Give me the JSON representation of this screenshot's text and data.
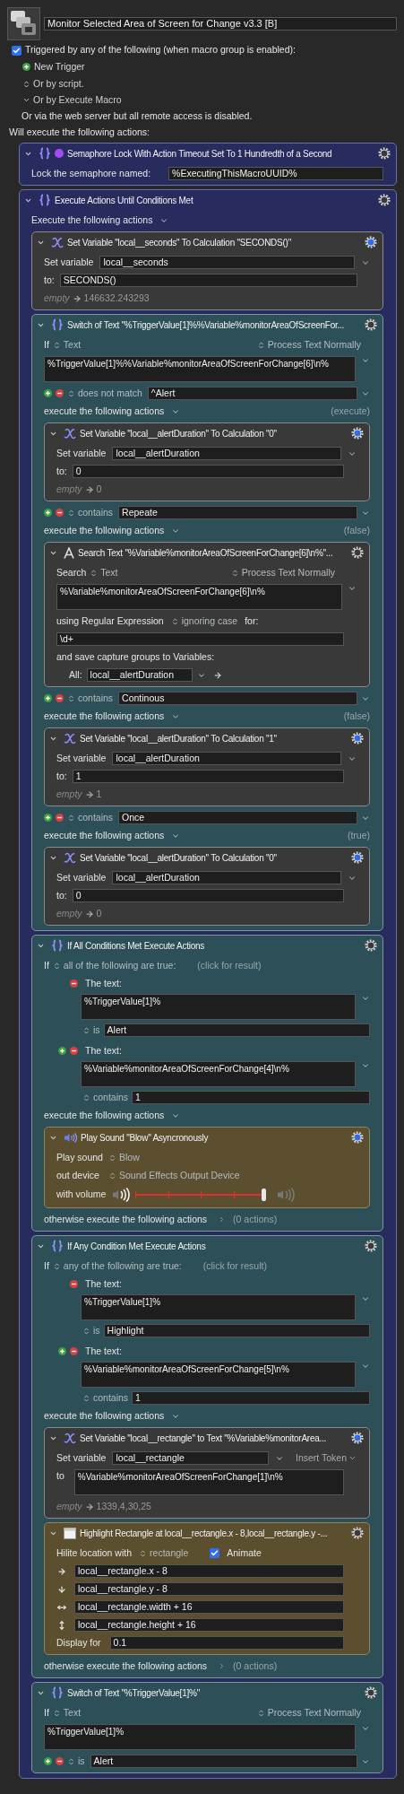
{
  "macro": {
    "title": "Monitor Selected Area of Screen for Change v3.3 [B]",
    "enabled": true,
    "triggered_label": "Triggered by any of the following (when macro group is enabled):",
    "new_trigger": "New Trigger",
    "script_option": "Or by script.",
    "execute_macro_option": "Or by Execute Macro",
    "web_note": "Or via the web server but all remote access is disabled.",
    "actions_heading": "Will execute the following actions:"
  },
  "actions": [
    {
      "kind": "semaphore",
      "title": "Semaphore Lock With Action Timeout Set To 1 Hundredth of a Second",
      "gear_active": false,
      "label": "Lock the semaphore named:",
      "value": "%ExecutingThisMacroUUID%"
    },
    {
      "kind": "until",
      "title": "Execute Actions Until Conditions Met",
      "gear_active": false,
      "exec_label": "Execute the following actions",
      "actions": [
        {
          "kind": "setvar",
          "title": "Set Variable \"local__seconds\" To Calculation \"SECONDS()\"",
          "gear_active": true,
          "var_label": "Set variable",
          "variable": "local__seconds",
          "to_label": "to:",
          "value": "SECONDS()",
          "result_label": "empty",
          "result": "146632.243293"
        },
        {
          "kind": "switch",
          "title": "Switch of Text \"%TriggerValue[1]%%Variable%monitorAreaOfScreenFor...",
          "gear_active": false,
          "if_label": "If",
          "source": "Text",
          "process": "Process Text Normally",
          "text": "%TriggerValue[1]%%Variable%monitorAreaOfScreenForChange[6]\\n%",
          "cases": [
            {
              "op": "does not match",
              "value": "^Alert",
              "exec_label": "execute the following actions",
              "status": "(execute)",
              "actions": [
                {
                  "kind": "setvar",
                  "title": "Set Variable \"local__alertDuration\" To Calculation \"0\"",
                  "gear_active": true,
                  "var_label": "Set variable",
                  "variable": "local__alertDuration",
                  "to_label": "to:",
                  "value": "0",
                  "result_label": "empty",
                  "result": "0"
                }
              ]
            },
            {
              "op": "contains",
              "value": "Repeate",
              "exec_label": "execute the following actions",
              "status": "(false)",
              "actions": [
                {
                  "kind": "search",
                  "title": "Search Text \"%Variable%monitorAreaOfScreenForChange[6]\\n%\"...",
                  "gear_active": false,
                  "search_label": "Search",
                  "source": "Text",
                  "process": "Process Text Normally",
                  "text": "%Variable%monitorAreaOfScreenForChange[6]\\n%",
                  "regex_label": "using Regular Expression",
                  "case_option": "ignoring case",
                  "for_label": "for:",
                  "pattern": "\\d+",
                  "capture_label": "and save capture groups to Variables:",
                  "all_label": "All:",
                  "variable": "local__alertDuration"
                }
              ]
            },
            {
              "op": "contains",
              "value": "Continous",
              "exec_label": "execute the following actions",
              "status": "(false)",
              "actions": [
                {
                  "kind": "setvar",
                  "title": "Set Variable \"local__alertDuration\" To Calculation \"1\"",
                  "gear_active": true,
                  "var_label": "Set variable",
                  "variable": "local__alertDuration",
                  "to_label": "to:",
                  "value": "1",
                  "result_label": "empty",
                  "result": "1"
                }
              ]
            },
            {
              "op": "contains",
              "value": "Once",
              "exec_label": "execute the following actions",
              "status": "(true)",
              "actions": [
                {
                  "kind": "setvar",
                  "title": "Set Variable \"local__alertDuration\" To Calculation \"0\"",
                  "gear_active": true,
                  "var_label": "Set variable",
                  "variable": "local__alertDuration",
                  "to_label": "to:",
                  "value": "0",
                  "result_label": "empty",
                  "result": "0"
                }
              ]
            }
          ]
        },
        {
          "kind": "if",
          "title": "If All Conditions Met Execute Actions",
          "gear_active": false,
          "if_label": "If",
          "mode": "all of the following are true:",
          "result_hint": "(click for result)",
          "conditions": [
            {
              "can_add": false,
              "label": "The text:",
              "text": "%TriggerValue[1]%",
              "match": {
                "op": "is",
                "value": "Alert"
              }
            },
            {
              "can_add": true,
              "label": "The text:",
              "text": "%Variable%monitorAreaOfScreenForChange[4]\\n%",
              "match": {
                "op": "contains",
                "value": "1"
              }
            }
          ],
          "exec_label": "execute the following actions",
          "actions": [
            {
              "kind": "sound",
              "title": "Play Sound \"Blow\" Asyncronously",
              "gear_active": true,
              "sound_label": "Play sound",
              "sound": "Blow",
              "device_label": "out device",
              "device": "Sound Effects Output Device",
              "volume_label": "with volume",
              "level": 1
            }
          ],
          "else_label": "otherwise execute the following actions",
          "else_count": "(0 actions)"
        },
        {
          "kind": "if",
          "title": "If Any Condition Met Execute Actions",
          "gear_active": false,
          "if_label": "If",
          "mode": "any of the following are true:",
          "result_hint": "(click for result)",
          "conditions": [
            {
              "can_add": false,
              "label": "The text:",
              "text": "%TriggerValue[1]%",
              "match": {
                "op": "is",
                "value": "Highlight"
              }
            },
            {
              "can_add": true,
              "label": "The text:",
              "text": "%Variable%monitorAreaOfScreenForChange[5]\\n%",
              "match": {
                "op": "contains",
                "value": "1"
              }
            }
          ],
          "exec_label": "execute the following actions",
          "actions": [
            {
              "kind": "settext",
              "title": "Set Variable \"local__rectangle\" to Text \"%Variable%monitorArea...",
              "gear_active": true,
              "var_label": "Set variable",
              "variable": "local__rectangle",
              "insert_token": "Insert Token",
              "to_label": "to",
              "value": "%Variable%monitorAreaOfScreenForChange[1]\\n%",
              "result_label": "empty",
              "result": "1339,4,30,25"
            },
            {
              "kind": "highlight",
              "title": "Highlight Rectangle at local__rectangle.x - 8,local__rectangle.y -...",
              "gear_active": false,
              "location_label": "Hilite location with",
              "location": "rectangle",
              "animate": true,
              "animate_label": "Animate",
              "fields": [
                {
                  "kind": "x",
                  "value": "local__rectangle.x - 8"
                },
                {
                  "kind": "y",
                  "value": "local__rectangle.y - 8"
                },
                {
                  "kind": "width",
                  "value": "local__rectangle.width + 16"
                },
                {
                  "kind": "height",
                  "value": "local__rectangle.height + 16"
                }
              ],
              "display_label": "Display for",
              "display": "0.1"
            }
          ],
          "else_label": "otherwise execute the following actions",
          "else_count": "(0 actions)"
        },
        {
          "kind": "switch",
          "title": "Switch of Text \"%TriggerValue[1]%\"",
          "gear_active": false,
          "if_label": "If",
          "source": "Text",
          "process": "Process Text Normally",
          "text": "%TriggerValue[1]%",
          "cases": [
            {
              "op": "is",
              "value": "Alert"
            }
          ]
        }
      ]
    }
  ]
}
